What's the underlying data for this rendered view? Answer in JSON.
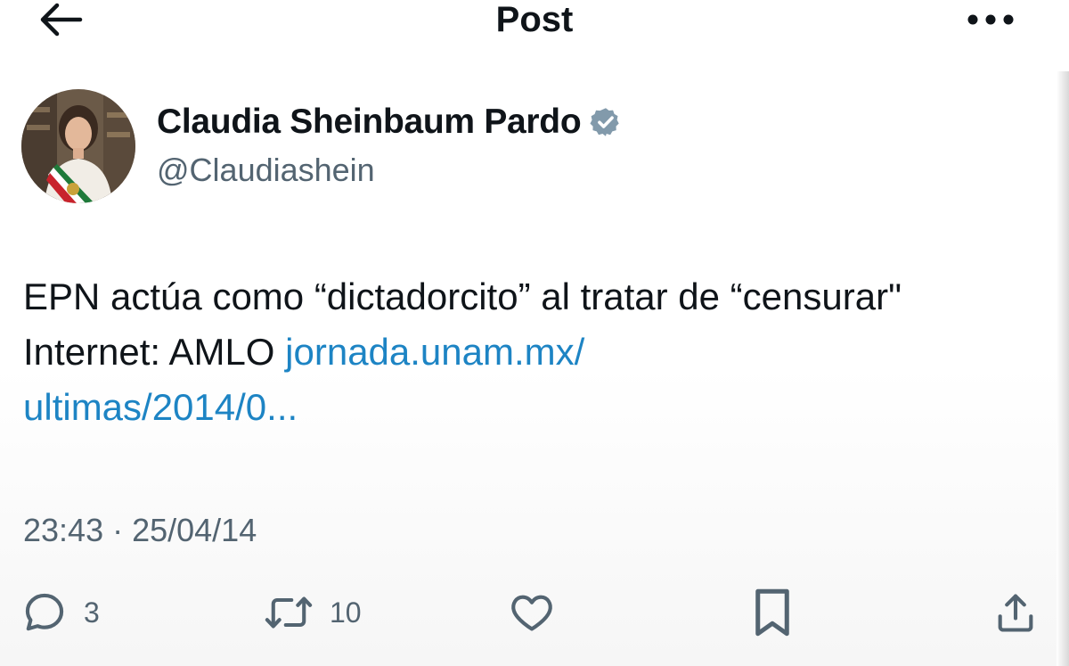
{
  "header": {
    "title": "Post",
    "back_icon": "arrow-left-icon",
    "more_icon": "more-horizontal-icon"
  },
  "author": {
    "name": "Claudia Sheinbaum Pardo",
    "handle": "@Claudiashein",
    "verified_icon": "verified-badge-icon",
    "verified_color": "#829aab"
  },
  "post": {
    "text": "EPN actúa como “dictadorcito” al tratar de “censurar\" Internet: AMLO ",
    "link_line1": "jornada.unam.mx/",
    "link_line2": "ultimas/2014/0...",
    "link_color": "#1d84c4",
    "timestamp": "23:43 · 25/04/14"
  },
  "actions": {
    "reply_count": "3",
    "repost_count": "10",
    "reply_icon": "reply-icon",
    "repost_icon": "repost-icon",
    "like_icon": "heart-icon",
    "bookmark_icon": "bookmark-icon",
    "share_icon": "share-icon"
  }
}
